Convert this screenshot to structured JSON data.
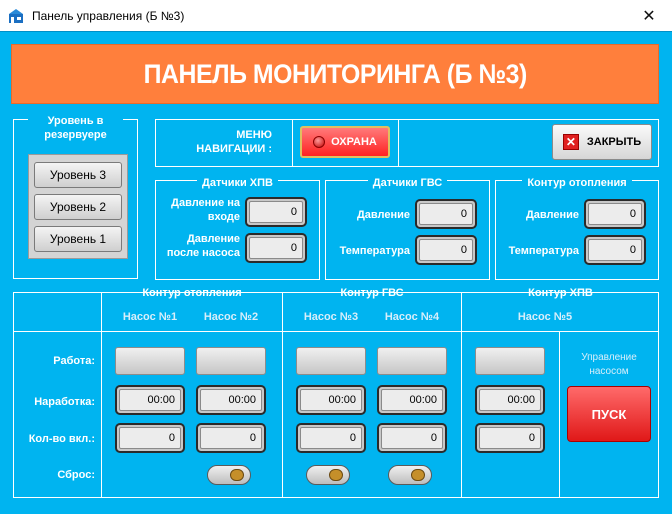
{
  "window": {
    "title": "Панель управления (Б №3)"
  },
  "header": {
    "title": "ПАНЕЛЬ МОНИТОРИНГА (Б №3)"
  },
  "level_panel": {
    "title": "Уровень в резервуере",
    "buttons": [
      "Уровень 3",
      "Уровень 2",
      "Уровень 1"
    ]
  },
  "nav": {
    "label": "МЕНЮ НАВИГАЦИИ :",
    "ohrana_label": "ОХРАНА",
    "close_label": "ЗАКРЫТЬ"
  },
  "sensors_hpv": {
    "title": "Датчики ХПВ",
    "pressure_in_label": "Давление на входе",
    "pressure_in_value": "0",
    "pressure_after_label": "Давление после насоса",
    "pressure_after_value": "0"
  },
  "sensors_gvs": {
    "title": "Датчики ГВС",
    "pressure_label": "Давление",
    "pressure_value": "0",
    "temp_label": "Температура",
    "temp_value": "0"
  },
  "heating_loop": {
    "title": "Контур отопления",
    "pressure_label": "Давление",
    "pressure_value": "0",
    "temp_label": "Температура",
    "temp_value": "0"
  },
  "pumps": {
    "group_titles": [
      "Контур отопления",
      "Контур ГВС",
      "Контур ХПВ"
    ],
    "names": [
      "Насос №1",
      "Насос №2",
      "Насос №3",
      "Насос №4",
      "Насос №5"
    ],
    "row_labels": [
      "Работа:",
      "Наработка:",
      "Кол-во вкл.:",
      "Сброс:"
    ],
    "runtime": [
      "00:00",
      "00:00",
      "00:00",
      "00:00",
      "00:00"
    ],
    "count": [
      "0",
      "0",
      "0",
      "0",
      "0"
    ],
    "control_label": "Управление насосом",
    "start_label": "ПУСК"
  },
  "colors": {
    "background": "#00b4f0",
    "header": "#ff7f3c",
    "alarm": "#f22222"
  },
  "icons": [
    "app-icon",
    "close-icon",
    "led-icon",
    "reset-knob-icon"
  ]
}
